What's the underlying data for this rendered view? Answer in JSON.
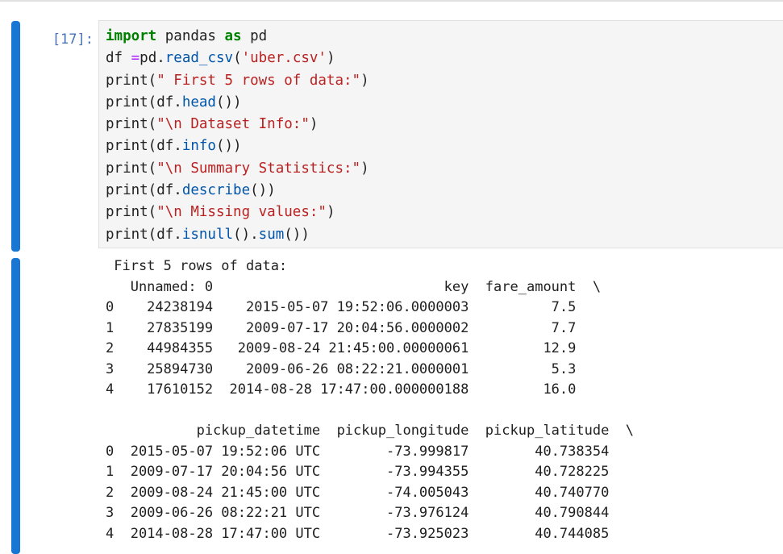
{
  "cell": {
    "prompt": "[17]:",
    "code": [
      [
        {
          "t": "import",
          "c": "kw"
        },
        {
          "t": " pandas "
        },
        {
          "t": "as",
          "c": "kw"
        },
        {
          "t": " pd"
        }
      ],
      [
        {
          "t": "df "
        },
        {
          "t": "=",
          "c": "op"
        },
        {
          "t": "pd."
        },
        {
          "t": "read_csv",
          "c": "fn"
        },
        {
          "t": "("
        },
        {
          "t": "'uber.csv'",
          "c": "str"
        },
        {
          "t": ")"
        }
      ],
      [
        {
          "t": "print("
        },
        {
          "t": "\" First 5 rows of data:\"",
          "c": "str"
        },
        {
          "t": ")"
        }
      ],
      [
        {
          "t": "print(df."
        },
        {
          "t": "head",
          "c": "fn"
        },
        {
          "t": "())"
        }
      ],
      [
        {
          "t": "print("
        },
        {
          "t": "\"\\n Dataset Info:\"",
          "c": "str"
        },
        {
          "t": ")"
        }
      ],
      [
        {
          "t": "print(df."
        },
        {
          "t": "info",
          "c": "fn"
        },
        {
          "t": "())"
        }
      ],
      [
        {
          "t": "print("
        },
        {
          "t": "\"\\n Summary Statistics:\"",
          "c": "str"
        },
        {
          "t": ")"
        }
      ],
      [
        {
          "t": "print(df."
        },
        {
          "t": "describe",
          "c": "fn"
        },
        {
          "t": "())"
        }
      ],
      [
        {
          "t": "print("
        },
        {
          "t": "\"\\n Missing values:\"",
          "c": "str"
        },
        {
          "t": ")"
        }
      ],
      [
        {
          "t": "print(df."
        },
        {
          "t": "isnull",
          "c": "fn"
        },
        {
          "t": "()."
        },
        {
          "t": "sum",
          "c": "fn"
        },
        {
          "t": "())"
        }
      ]
    ]
  },
  "output": {
    "lines": [
      " First 5 rows of data:",
      "   Unnamed: 0                            key  fare_amount  \\",
      "0    24238194    2015-05-07 19:52:06.0000003          7.5   ",
      "1    27835199    2009-07-17 20:04:56.0000002          7.7   ",
      "2    44984355   2009-08-24 21:45:00.00000061         12.9   ",
      "3    25894730    2009-06-26 08:22:21.0000001          5.3   ",
      "4    17610152  2014-08-28 17:47:00.000000188         16.0   ",
      "",
      "           pickup_datetime  pickup_longitude  pickup_latitude  \\",
      "0  2015-05-07 19:52:06 UTC        -73.999817        40.738354   ",
      "1  2009-07-17 20:04:56 UTC        -73.994355        40.728225   ",
      "2  2009-08-24 21:45:00 UTC        -74.005043        40.740770   ",
      "3  2009-06-26 08:22:21 UTC        -73.976124        40.790844   ",
      "4  2014-08-28 17:47:00 UTC        -73.925023        40.744085   "
    ]
  }
}
